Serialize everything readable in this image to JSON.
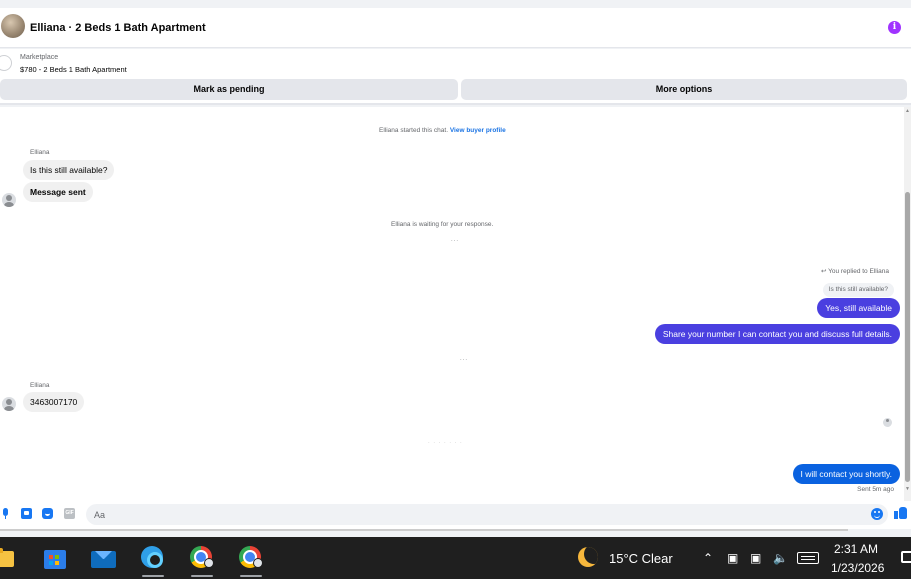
{
  "header": {
    "title": "Elliana · 2 Beds 1 Bath Apartment"
  },
  "listing": {
    "source": "Marketplace",
    "title": "$780 - 2 Beds 1 Bath Apartment"
  },
  "actions": {
    "mark_pending": "Mark as pending",
    "more_options": "More options"
  },
  "chat": {
    "started_text": "Elliana started this chat.",
    "view_profile": "View buyer profile",
    "waiting_text": "Elliana is waiting for your response.",
    "replied_text": "You replied to Elliana",
    "sent_status": "Sent 5m ago",
    "messages": [
      {
        "sender": "Elliana",
        "text": "Is this still available?"
      },
      {
        "text": "Message sent"
      },
      {
        "quote": "Is this still available?",
        "text": "Yes, still available"
      },
      {
        "text": "Share your number I can contact you and discuss full details."
      },
      {
        "sender": "Elliana",
        "text": "3463007170"
      },
      {
        "text": "I will contact you shortly."
      }
    ]
  },
  "composer": {
    "placeholder": "Aa",
    "gif_label": "GIF"
  },
  "taskbar": {
    "apps": [
      "file-explorer-icon",
      "microsoft-store-icon",
      "mail-icon",
      "edge-icon",
      "chrome-icon",
      "chrome-icon"
    ],
    "weather": "15°C  Clear",
    "time": "2:31 AM",
    "date": "1/23/2026"
  },
  "colors": {
    "outgoing_bubble": "#4a3fe0",
    "outgoing_latest": "#0a62e0",
    "accent": "#1877f2",
    "info": "#a033ff"
  }
}
